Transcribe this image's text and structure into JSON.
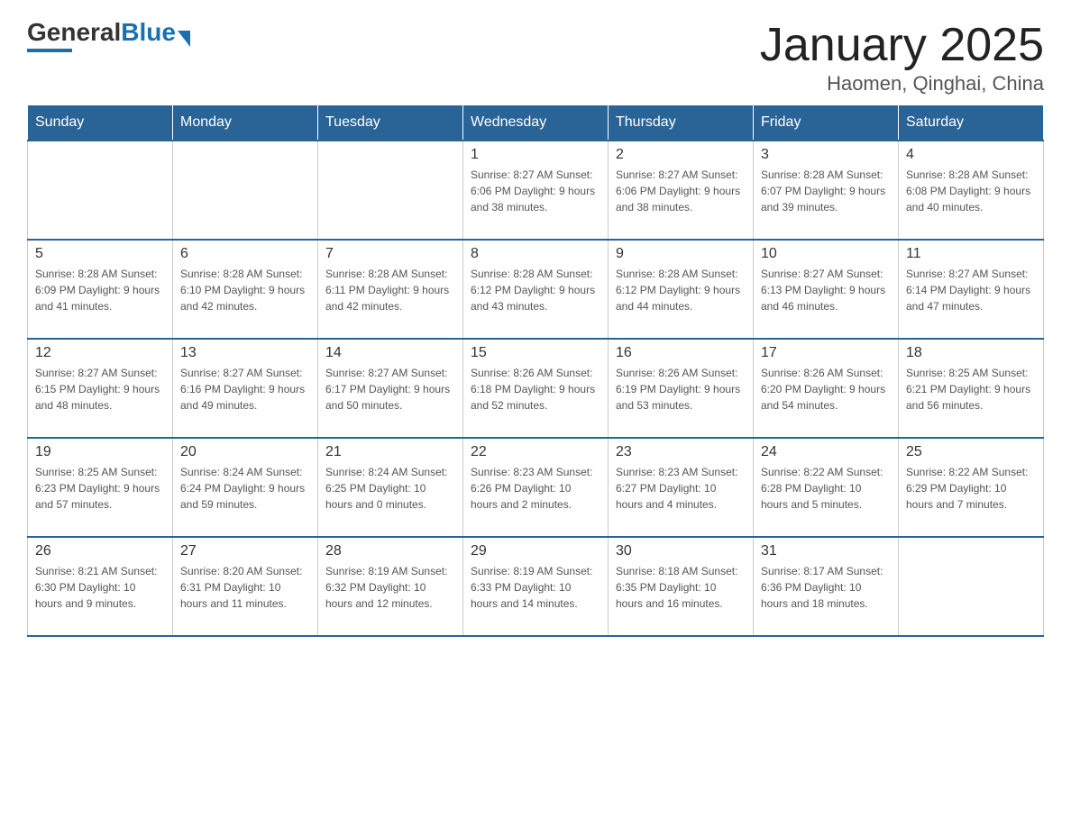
{
  "header": {
    "title": "January 2025",
    "subtitle": "Haomen, Qinghai, China",
    "logo": {
      "general": "General",
      "blue": "Blue"
    }
  },
  "days_of_week": [
    "Sunday",
    "Monday",
    "Tuesday",
    "Wednesday",
    "Thursday",
    "Friday",
    "Saturday"
  ],
  "weeks": [
    [
      {
        "day": "",
        "info": ""
      },
      {
        "day": "",
        "info": ""
      },
      {
        "day": "",
        "info": ""
      },
      {
        "day": "1",
        "info": "Sunrise: 8:27 AM\nSunset: 6:06 PM\nDaylight: 9 hours and 38 minutes."
      },
      {
        "day": "2",
        "info": "Sunrise: 8:27 AM\nSunset: 6:06 PM\nDaylight: 9 hours and 38 minutes."
      },
      {
        "day": "3",
        "info": "Sunrise: 8:28 AM\nSunset: 6:07 PM\nDaylight: 9 hours and 39 minutes."
      },
      {
        "day": "4",
        "info": "Sunrise: 8:28 AM\nSunset: 6:08 PM\nDaylight: 9 hours and 40 minutes."
      }
    ],
    [
      {
        "day": "5",
        "info": "Sunrise: 8:28 AM\nSunset: 6:09 PM\nDaylight: 9 hours and 41 minutes."
      },
      {
        "day": "6",
        "info": "Sunrise: 8:28 AM\nSunset: 6:10 PM\nDaylight: 9 hours and 42 minutes."
      },
      {
        "day": "7",
        "info": "Sunrise: 8:28 AM\nSunset: 6:11 PM\nDaylight: 9 hours and 42 minutes."
      },
      {
        "day": "8",
        "info": "Sunrise: 8:28 AM\nSunset: 6:12 PM\nDaylight: 9 hours and 43 minutes."
      },
      {
        "day": "9",
        "info": "Sunrise: 8:28 AM\nSunset: 6:12 PM\nDaylight: 9 hours and 44 minutes."
      },
      {
        "day": "10",
        "info": "Sunrise: 8:27 AM\nSunset: 6:13 PM\nDaylight: 9 hours and 46 minutes."
      },
      {
        "day": "11",
        "info": "Sunrise: 8:27 AM\nSunset: 6:14 PM\nDaylight: 9 hours and 47 minutes."
      }
    ],
    [
      {
        "day": "12",
        "info": "Sunrise: 8:27 AM\nSunset: 6:15 PM\nDaylight: 9 hours and 48 minutes."
      },
      {
        "day": "13",
        "info": "Sunrise: 8:27 AM\nSunset: 6:16 PM\nDaylight: 9 hours and 49 minutes."
      },
      {
        "day": "14",
        "info": "Sunrise: 8:27 AM\nSunset: 6:17 PM\nDaylight: 9 hours and 50 minutes."
      },
      {
        "day": "15",
        "info": "Sunrise: 8:26 AM\nSunset: 6:18 PM\nDaylight: 9 hours and 52 minutes."
      },
      {
        "day": "16",
        "info": "Sunrise: 8:26 AM\nSunset: 6:19 PM\nDaylight: 9 hours and 53 minutes."
      },
      {
        "day": "17",
        "info": "Sunrise: 8:26 AM\nSunset: 6:20 PM\nDaylight: 9 hours and 54 minutes."
      },
      {
        "day": "18",
        "info": "Sunrise: 8:25 AM\nSunset: 6:21 PM\nDaylight: 9 hours and 56 minutes."
      }
    ],
    [
      {
        "day": "19",
        "info": "Sunrise: 8:25 AM\nSunset: 6:23 PM\nDaylight: 9 hours and 57 minutes."
      },
      {
        "day": "20",
        "info": "Sunrise: 8:24 AM\nSunset: 6:24 PM\nDaylight: 9 hours and 59 minutes."
      },
      {
        "day": "21",
        "info": "Sunrise: 8:24 AM\nSunset: 6:25 PM\nDaylight: 10 hours and 0 minutes."
      },
      {
        "day": "22",
        "info": "Sunrise: 8:23 AM\nSunset: 6:26 PM\nDaylight: 10 hours and 2 minutes."
      },
      {
        "day": "23",
        "info": "Sunrise: 8:23 AM\nSunset: 6:27 PM\nDaylight: 10 hours and 4 minutes."
      },
      {
        "day": "24",
        "info": "Sunrise: 8:22 AM\nSunset: 6:28 PM\nDaylight: 10 hours and 5 minutes."
      },
      {
        "day": "25",
        "info": "Sunrise: 8:22 AM\nSunset: 6:29 PM\nDaylight: 10 hours and 7 minutes."
      }
    ],
    [
      {
        "day": "26",
        "info": "Sunrise: 8:21 AM\nSunset: 6:30 PM\nDaylight: 10 hours and 9 minutes."
      },
      {
        "day": "27",
        "info": "Sunrise: 8:20 AM\nSunset: 6:31 PM\nDaylight: 10 hours and 11 minutes."
      },
      {
        "day": "28",
        "info": "Sunrise: 8:19 AM\nSunset: 6:32 PM\nDaylight: 10 hours and 12 minutes."
      },
      {
        "day": "29",
        "info": "Sunrise: 8:19 AM\nSunset: 6:33 PM\nDaylight: 10 hours and 14 minutes."
      },
      {
        "day": "30",
        "info": "Sunrise: 8:18 AM\nSunset: 6:35 PM\nDaylight: 10 hours and 16 minutes."
      },
      {
        "day": "31",
        "info": "Sunrise: 8:17 AM\nSunset: 6:36 PM\nDaylight: 10 hours and 18 minutes."
      },
      {
        "day": "",
        "info": ""
      }
    ]
  ]
}
